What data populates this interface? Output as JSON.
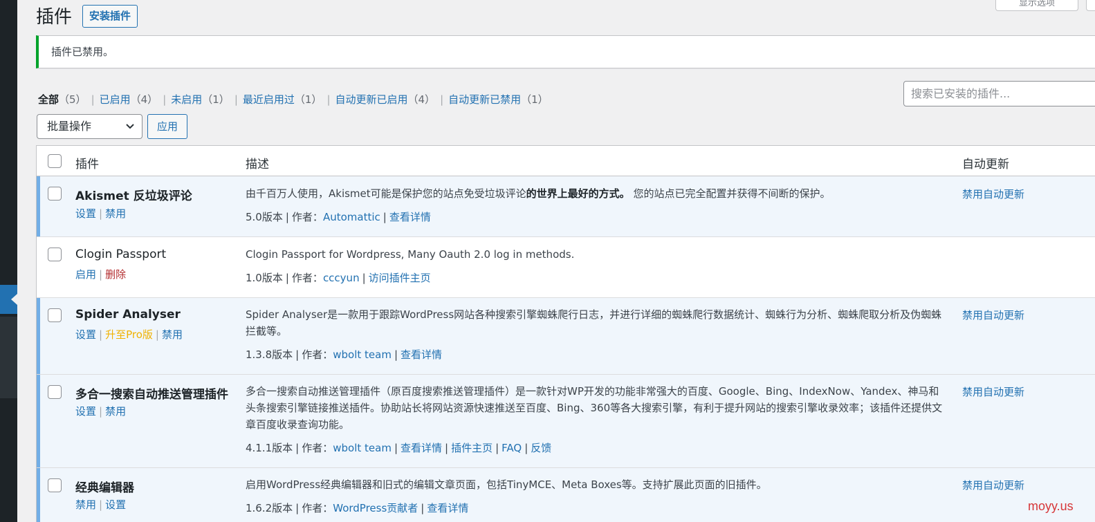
{
  "header": {
    "title": "插件",
    "add_button": "安装插件",
    "screen_options": "显示选项"
  },
  "notice": {
    "text": "插件已禁用。"
  },
  "filters": {
    "all": {
      "label": "全部",
      "count": "（5）"
    },
    "active": {
      "label": "已启用",
      "count": "（4）"
    },
    "inactive": {
      "label": "未启用",
      "count": "（1）"
    },
    "recent": {
      "label": "最近启用过",
      "count": "（1）"
    },
    "auto_on": {
      "label": "自动更新已启用",
      "count": "（4）"
    },
    "auto_off": {
      "label": "自动更新已禁用",
      "count": "（1）"
    },
    "separator": "|"
  },
  "search": {
    "placeholder": "搜索已安装的插件..."
  },
  "bulk": {
    "selected": "批量操作",
    "apply": "应用"
  },
  "table": {
    "columns": {
      "plugin": "插件",
      "description": "描述",
      "auto_update": "自动更新"
    },
    "rows": [
      {
        "name": "Akismet 反垃圾评论",
        "actions": [
          "设置",
          "禁用"
        ],
        "description": "由千百万人使用，Akismet可能是保护您的站点免受垃圾评论",
        "description_bold": "的世界上最好的方式。",
        "description_tail": " 您的站点已完全配置并获得不间断的保护。",
        "version": "5.0版本",
        "author_label": "作者：",
        "author": "Automattic",
        "links": [
          "查看详情"
        ],
        "auto_update": "禁用自动更新"
      },
      {
        "name": "Clogin Passport",
        "actions": [
          "启用",
          "删除"
        ],
        "description": "Clogin Passport for Wordpress, Many Oauth 2.0 log in methods.",
        "version": "1.0版本",
        "author_label": "作者：",
        "author": "cccyun",
        "links": [
          "访问插件主页"
        ],
        "auto_update": ""
      },
      {
        "name": "Spider Analyser",
        "actions": [
          "设置",
          "升至Pro版",
          "禁用"
        ],
        "description": "Spider Analyser是一款用于跟踪WordPress网站各种搜索引擎蜘蛛爬行日志，并进行详细的蜘蛛爬行数据统计、蜘蛛行为分析、蜘蛛爬取分析及伪蜘蛛拦截等。",
        "version": "1.3.8版本",
        "author_label": "作者：",
        "author": "wbolt team",
        "links": [
          "查看详情"
        ],
        "auto_update": "禁用自动更新"
      },
      {
        "name": "多合一搜索自动推送管理插件",
        "actions": [
          "设置",
          "禁用"
        ],
        "description": "多合一搜索自动推送管理插件（原百度搜索推送管理插件）是一款针对WP开发的功能非常强大的百度、Google、Bing、IndexNow、Yandex、神马和头条搜索引擎链接推送插件。协助站长将网站资源快速推送至百度、Bing、360等各大搜索引擎，有利于提升网站的搜索引擎收录效率；该插件还提供文章百度收录查询功能。",
        "version": "4.1.1版本",
        "author_label": "作者：",
        "author": "wbolt team",
        "links": [
          "查看详情",
          "插件主页",
          "FAQ",
          "反馈"
        ],
        "auto_update": "禁用自动更新"
      },
      {
        "name": "经典编辑器",
        "actions": [
          "禁用",
          "设置"
        ],
        "description": "启用WordPress经典编辑器和旧式的编辑文章页面，包括TinyMCE、Meta Boxes等。支持扩展此页面的旧插件。",
        "version": "1.6.2版本",
        "author_label": "作者：",
        "author": "WordPress贡献者",
        "links": [
          "查看详情"
        ],
        "auto_update": "禁用自动更新"
      }
    ]
  },
  "watermark": "moyy.us",
  "colors": {
    "link": "#2271b1",
    "active_row_bg": "#f0f6fc",
    "active_row_border": "#72aee6",
    "notice_border": "#00a32a",
    "delete": "#b32d2e",
    "pro": "#f0b100",
    "watermark": "#d63638"
  }
}
